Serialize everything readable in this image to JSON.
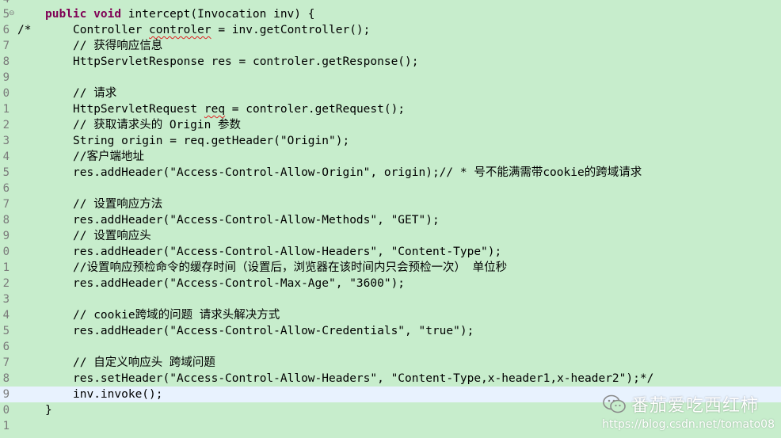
{
  "editor": {
    "line_numbers": [
      "4",
      "5",
      "6",
      "7",
      "8",
      "9",
      "0",
      "1",
      "2",
      "3",
      "4",
      "5",
      "6",
      "7",
      "8",
      "9",
      "0",
      "1",
      "2",
      "3",
      "4",
      "5",
      "6",
      "7",
      "8",
      "9",
      "0",
      "1"
    ],
    "lines": [
      "",
      "public void intercept(Invocation inv) {",
      "/*",
      "// 获得响应信息",
      "HttpServletResponse res = controler.getResponse();",
      "",
      "// 请求",
      "HttpServletRequest req = controler.getRequest();",
      "// 获取请求头的 Origin 参数",
      "String origin = req.getHeader(\"Origin\");",
      "//客户端地址",
      "res.addHeader(\"Access-Control-Allow-Origin\", origin);// * 号不能满需带cookie的跨域请求",
      "",
      "// 设置响应方法",
      "res.addHeader(\"Access-Control-Allow-Methods\", \"GET\");",
      "// 设置响应头",
      "res.addHeader(\"Access-Control-Allow-Headers\", \"Content-Type\");",
      "//设置响应预检命令的缓存时间（设置后，浏览器在该时间内只会预检一次） 单位秒",
      "res.addHeader(\"Access-Control-Max-Age\", \"3600\");",
      "",
      "// cookie跨域的问题 请求头解决方式",
      "res.addHeader(\"Access-Control-Allow-Credentials\", \"true\");",
      "",
      "// 自定义响应头 跨域问题",
      "res.setHeader(\"Access-Control-Allow-Headers\", \"Content-Type,x-header1,x-header2\");*/",
      "inv.invoke();",
      "}",
      ""
    ],
    "line6_part1": "Controller ",
    "line6_squiggle": "controler",
    "line6_part2": " = inv.getController();",
    "line11_part1": "HttpServletRequest ",
    "line11_squiggle": "req",
    "line11_part2": " = controler.getRequest();",
    "kw_public": "public",
    "kw_void": "void",
    "sig_rest": " intercept(Invocation inv) {",
    "fold_marker": "⊖"
  },
  "watermark": {
    "title": "番茄爱吃西红柿",
    "url": "https://blog.csdn.net/tomato08",
    "icon": "wechat-icon"
  },
  "colors": {
    "background": "#c7edcc",
    "current_line": "#e8f2fe",
    "keyword": "#7f0055",
    "squiggle": "#e02020"
  }
}
